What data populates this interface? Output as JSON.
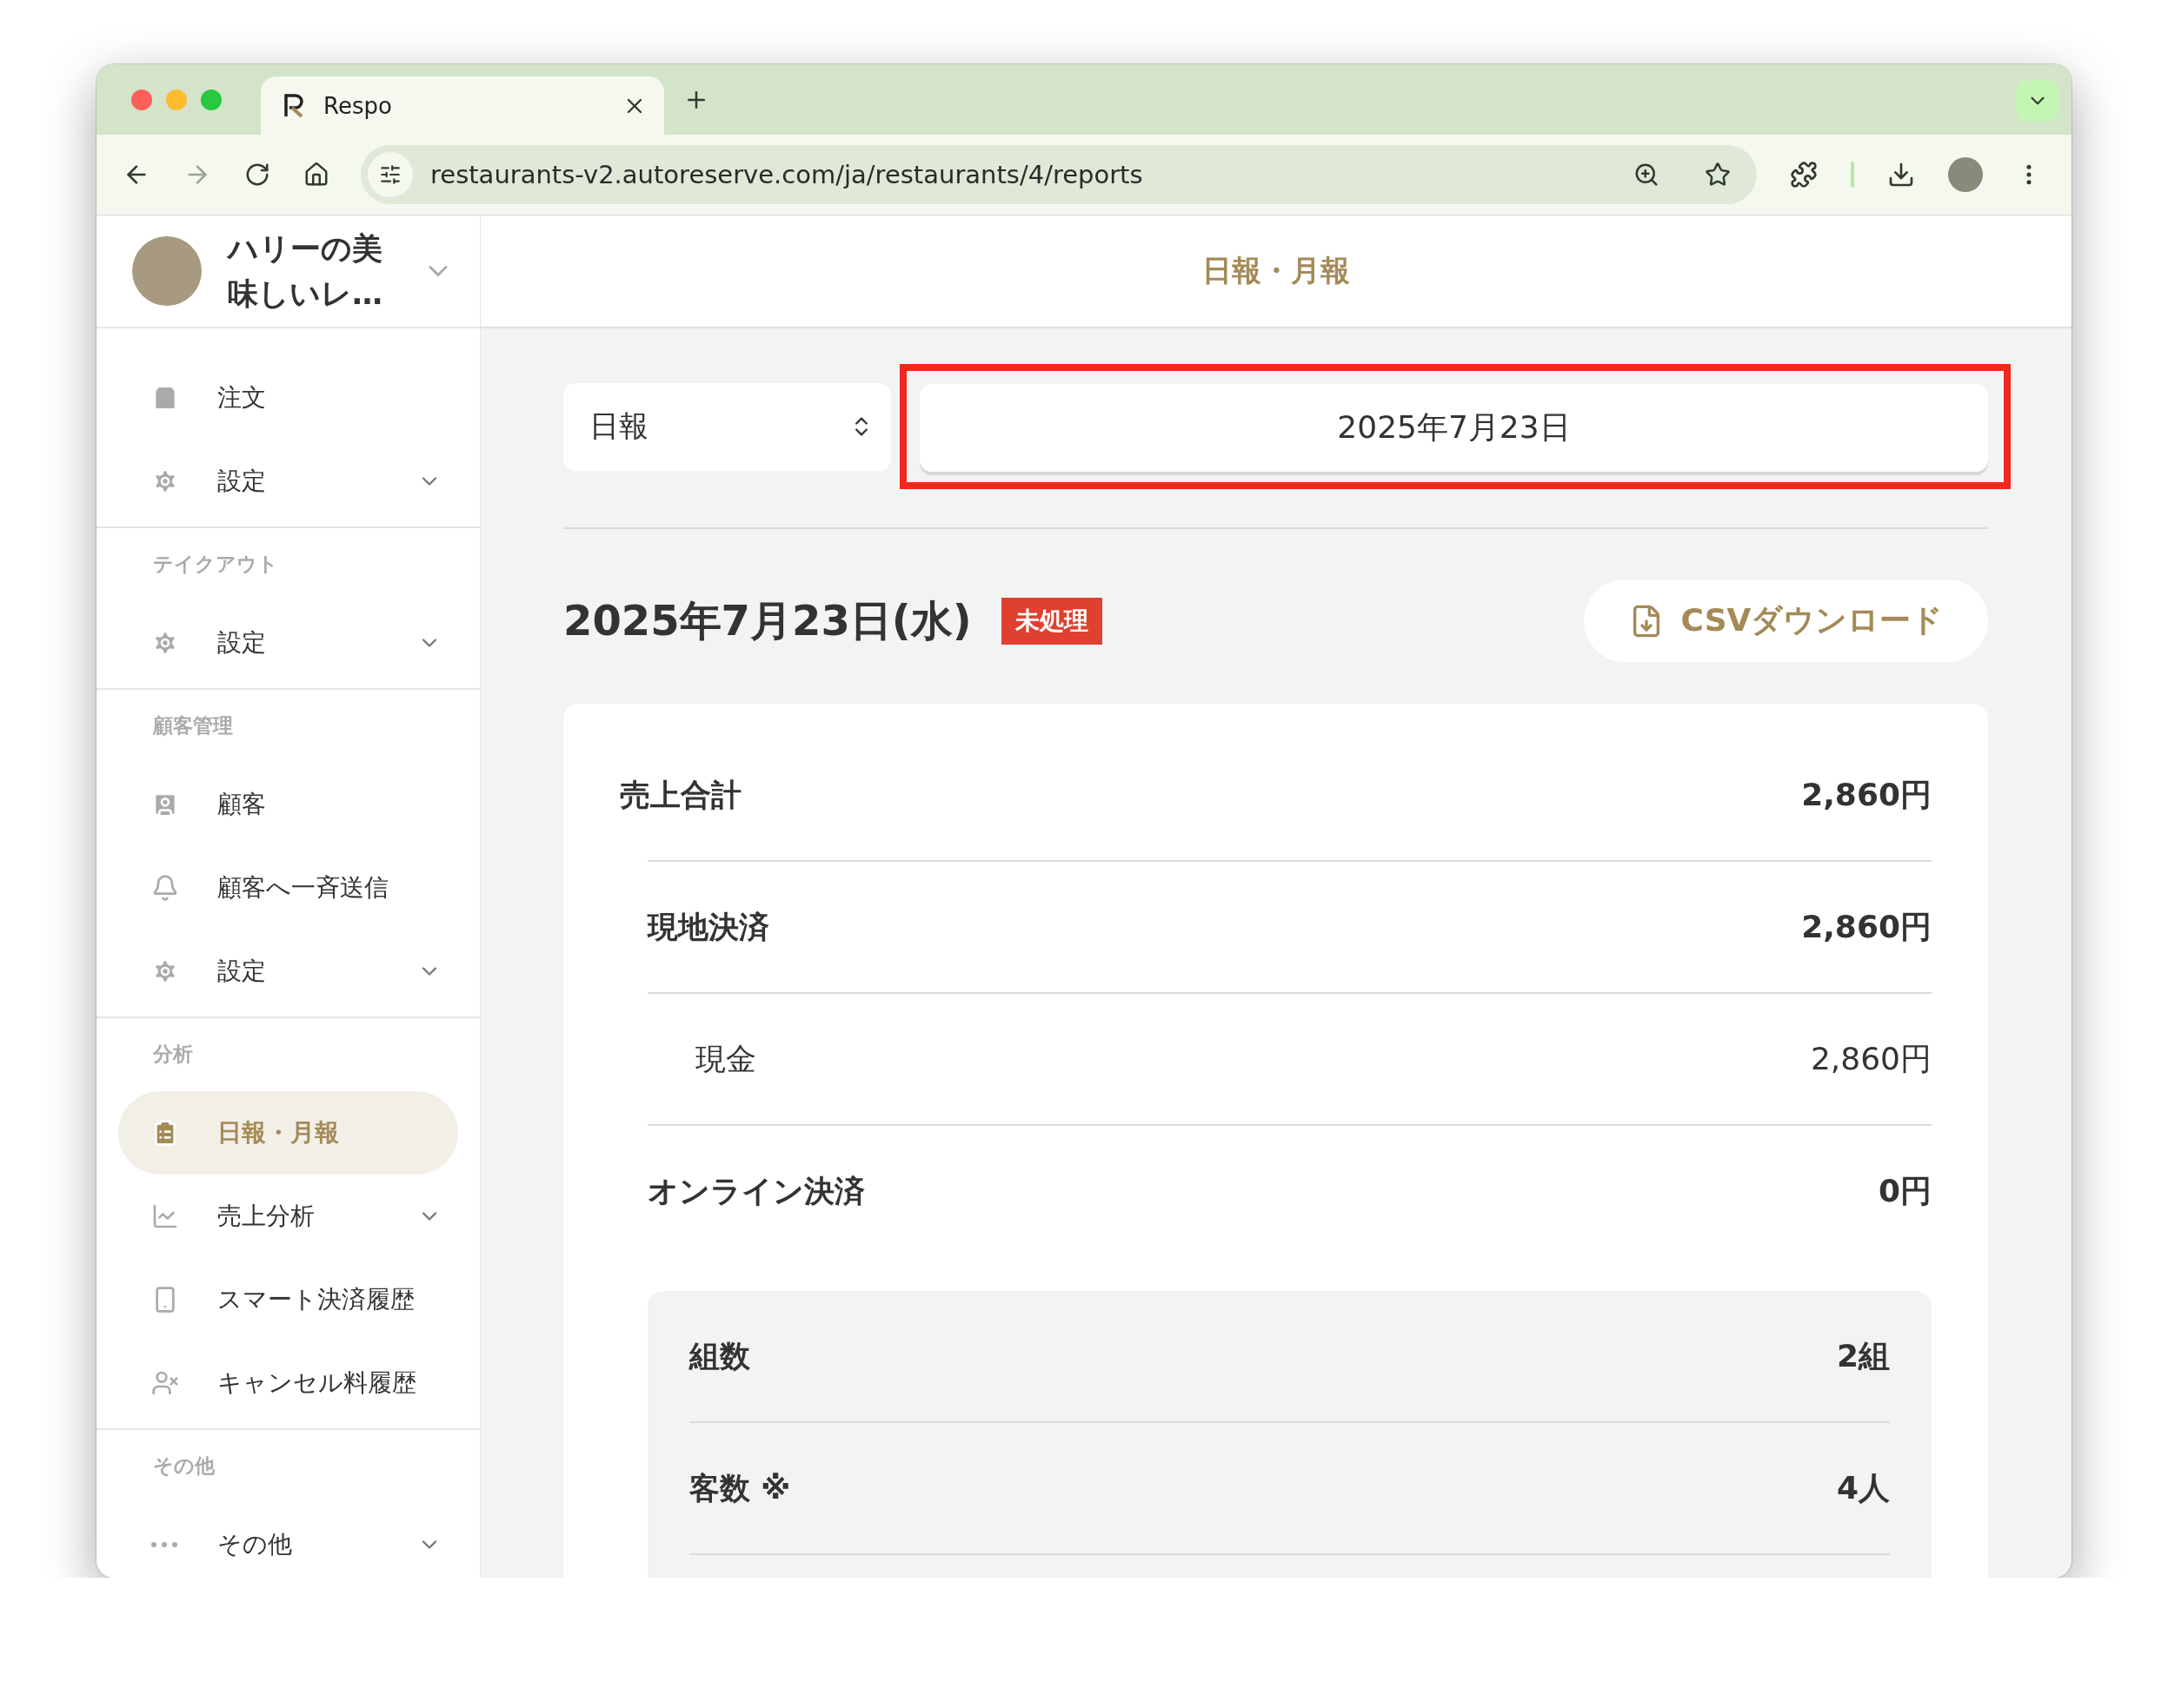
{
  "browser": {
    "tab_title": "Respo",
    "url": "restaurants-v2.autoreserve.com/ja/restaurants/4/reports"
  },
  "sidebar": {
    "restaurant_name": "ハリーの美味しいレ…",
    "sections": [
      {
        "items": [
          {
            "label": "注文",
            "selected": false,
            "expandable": false
          },
          {
            "label": "設定",
            "selected": false,
            "expandable": true
          }
        ]
      },
      {
        "heading": "テイクアウト",
        "items": [
          {
            "label": "設定",
            "selected": false,
            "expandable": true
          }
        ]
      },
      {
        "heading": "顧客管理",
        "items": [
          {
            "label": "顧客",
            "selected": false,
            "expandable": false
          },
          {
            "label": "顧客へ一斉送信",
            "selected": false,
            "expandable": false
          },
          {
            "label": "設定",
            "selected": false,
            "expandable": true
          }
        ]
      },
      {
        "heading": "分析",
        "items": [
          {
            "label": "日報・月報",
            "selected": true,
            "expandable": false
          },
          {
            "label": "売上分析",
            "selected": false,
            "expandable": true
          },
          {
            "label": "スマート決済履歴",
            "selected": false,
            "expandable": false
          },
          {
            "label": "キャンセル料履歴",
            "selected": false,
            "expandable": false
          }
        ]
      },
      {
        "heading": "その他",
        "items": [
          {
            "label": "その他",
            "selected": false,
            "expandable": true
          }
        ]
      }
    ]
  },
  "main": {
    "title": "日報・月報",
    "period_select": "日報",
    "date_field": "2025年7月23日",
    "report_date": "2025年7月23日(水)",
    "status_badge": "未処理",
    "csv_button": "CSVダウンロード",
    "rows": [
      {
        "kind": "total",
        "label": "売上合計",
        "value": "2,860円"
      },
      {
        "kind": "method",
        "label": "現地決済",
        "value": "2,860円"
      },
      {
        "kind": "detail",
        "label": "現金",
        "value": "2,860円"
      },
      {
        "kind": "method",
        "label": "オンライン決済",
        "value": "0円"
      }
    ],
    "stats": [
      {
        "label": "組数",
        "value": "2組"
      },
      {
        "label": "客数 ※",
        "value": "4人"
      }
    ]
  }
}
